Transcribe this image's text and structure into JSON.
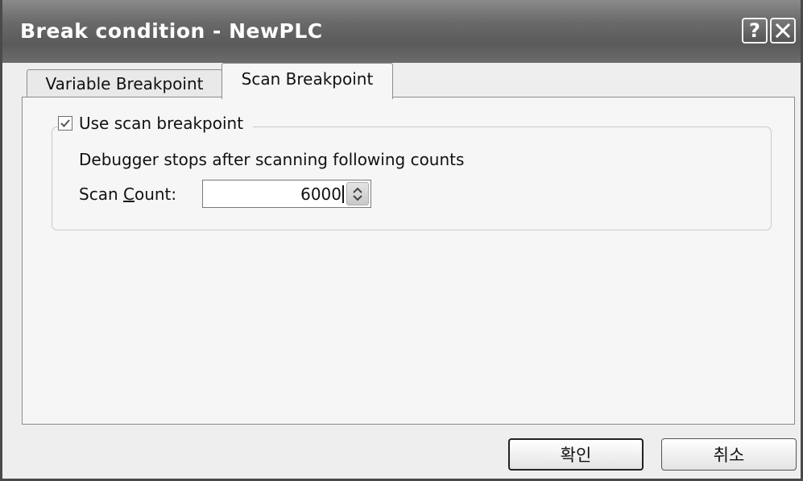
{
  "window": {
    "title": "Break condition - NewPLC",
    "help_label": "?"
  },
  "tabs": [
    {
      "label": "Variable Breakpoint",
      "active": false
    },
    {
      "label": "Scan Breakpoint",
      "active": true
    }
  ],
  "scan_breakpoint": {
    "checkbox_label": "Use scan breakpoint",
    "checked": true,
    "description": "Debugger stops after scanning following counts",
    "scan_count_label_pre": "Scan ",
    "scan_count_label_accel": "C",
    "scan_count_label_post": "ount:",
    "scan_count_value": "6000"
  },
  "buttons": {
    "ok_label": "확인",
    "cancel_label": "취소"
  },
  "icons": {
    "help": "help-icon",
    "close": "close-icon",
    "check": "checkmark-icon",
    "spin_up": "chevron-up-icon",
    "spin_down": "chevron-down-icon"
  }
}
